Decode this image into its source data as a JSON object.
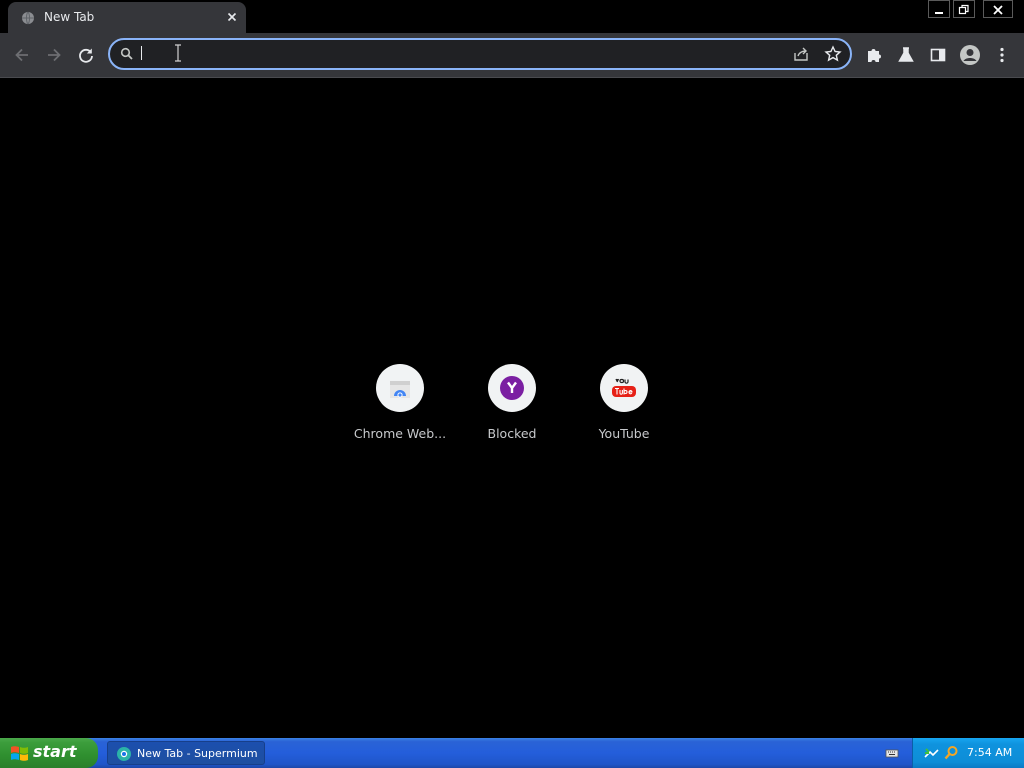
{
  "tab": {
    "title": "New Tab"
  },
  "omnibox": {
    "value": "",
    "placeholder": ""
  },
  "shortcuts": [
    {
      "label": "Chrome Web..."
    },
    {
      "label": "Blocked"
    },
    {
      "label": "YouTube"
    }
  ],
  "taskbar": {
    "start_label": "start",
    "task_label": "New Tab - Supermium",
    "clock": "7:54 AM"
  },
  "colors": {
    "accent": "#8ab4f8",
    "tab_bg": "#35363a",
    "ntp_bg": "#000000",
    "xp_blue": "#245edb",
    "xp_green": "#3c9d3c"
  }
}
